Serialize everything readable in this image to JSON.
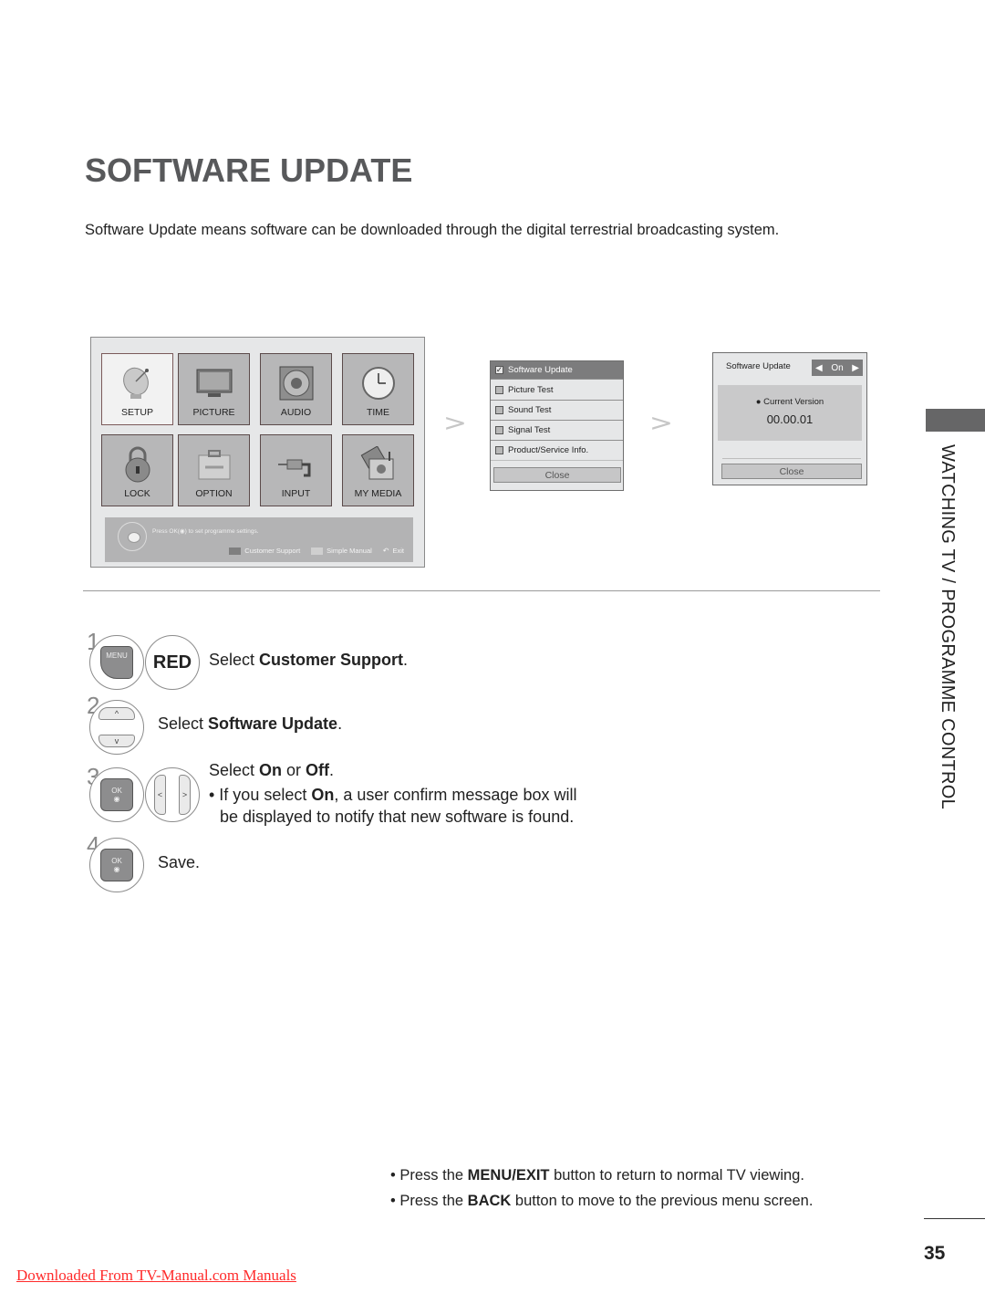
{
  "page": {
    "title": "SOFTWARE UPDATE",
    "intro": "Software Update means software can be downloaded through the digital terrestrial broadcasting system.",
    "side_tab": "WATCHING TV / PROGRAMME CONTROL",
    "page_number": "35",
    "source_link": "Downloaded From TV-Manual.com Manuals"
  },
  "tv_menu": {
    "tiles": [
      {
        "label": "SETUP",
        "icon": "satellite-dish-icon",
        "active": true
      },
      {
        "label": "PICTURE",
        "icon": "tv-monitor-icon"
      },
      {
        "label": "AUDIO",
        "icon": "speaker-icon"
      },
      {
        "label": "TIME",
        "icon": "clock-icon"
      },
      {
        "label": "LOCK",
        "icon": "padlock-icon"
      },
      {
        "label": "OPTION",
        "icon": "toolbox-icon"
      },
      {
        "label": "INPUT",
        "icon": "cable-plug-icon"
      },
      {
        "label": "MY MEDIA",
        "icon": "media-photos-icon"
      }
    ],
    "footer": {
      "hint_prefix": "Press OK(",
      "hint_suffix": ") to set programme settings.",
      "customer_support": "Customer Support",
      "simple_manual": "Simple Manual",
      "exit": "Exit"
    }
  },
  "support_menu": {
    "items": [
      {
        "label": "Software Update",
        "checked": true
      },
      {
        "label": "Picture Test",
        "checked": false
      },
      {
        "label": "Sound Test",
        "checked": false
      },
      {
        "label": "Signal Test",
        "checked": false
      },
      {
        "label": "Product/Service Info.",
        "checked": false
      }
    ],
    "close": "Close"
  },
  "update_panel": {
    "label": "Software Update",
    "value": "On",
    "left_arrow": "◀",
    "right_arrow": "▶",
    "version_label": "● Current Version",
    "version": "00.00.01",
    "close": "Close"
  },
  "arrows": ">",
  "steps": [
    {
      "num": "1",
      "button": "MENU",
      "key": "RED",
      "pre": "Select ",
      "bold": "Customer Support",
      "post": "."
    },
    {
      "num": "2",
      "up": "^",
      "down": "v",
      "pre": "Select ",
      "bold": "Software Update",
      "post": "."
    },
    {
      "num": "3",
      "button": "OK",
      "left": "<",
      "right": ">",
      "pre": "Select ",
      "bold": "On",
      "mid": " or ",
      "bold2": "Off",
      "post": ".",
      "bullet_pre": "• If you select ",
      "bullet_bold": "On",
      "bullet_post": ", a user confirm message box will",
      "bullet_line2": "be displayed to notify that new software is found."
    },
    {
      "num": "4",
      "button": "OK",
      "text": "Save."
    }
  ],
  "notes": [
    {
      "pre": "• Press the ",
      "bold": "MENU/EXIT",
      "post": " button to return to normal TV viewing."
    },
    {
      "pre": "• Press the ",
      "bold": "BACK",
      "post": " button to move to the previous menu screen."
    }
  ]
}
